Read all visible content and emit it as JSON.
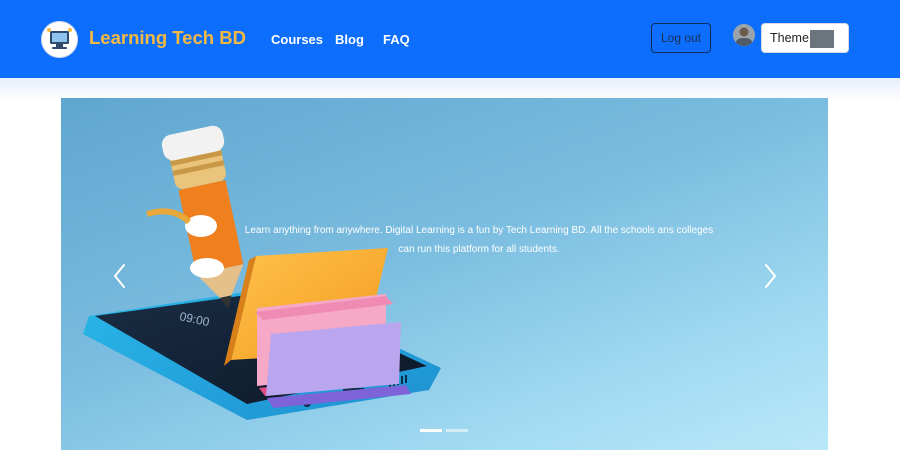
{
  "header": {
    "brand": "Learning Tech BD",
    "nav": [
      "Courses",
      "Blog",
      "FAQ"
    ],
    "logout_label": "Log out",
    "theme_label": "Theme"
  },
  "hero": {
    "caption": "Learn anything from anywhere. Digital Learning is a fun by Tech Learning BD. All the schools ans colleges can run this platform for all students.",
    "phone_time": "09:00",
    "slide_count": 2,
    "active_slide": 1
  },
  "colors": {
    "navbar": "#0d6efd",
    "brand": "#f4b942",
    "theme_swatch": "#6c757d"
  }
}
